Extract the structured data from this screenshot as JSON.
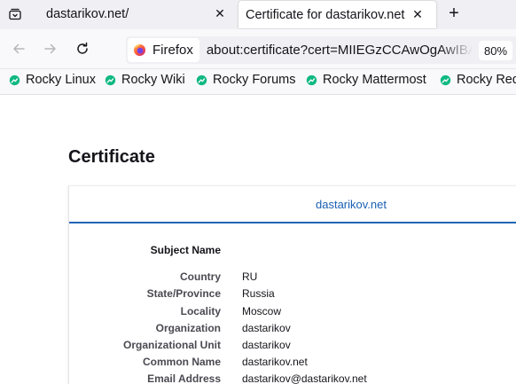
{
  "tabs": [
    {
      "title": "dastarikov.net/",
      "active": false
    },
    {
      "title": "Certificate for dastarikov.net",
      "active": true
    }
  ],
  "icons": {
    "tab_list": "tab-list-icon",
    "close": "close-icon",
    "new_tab": "plus-icon",
    "back": "arrow-left-icon",
    "forward": "arrow-right-icon",
    "reload": "reload-icon",
    "identity": "firefox-logo-icon",
    "bookmark": "rocky-logo-icon"
  },
  "glyphs": {
    "close": "✕",
    "new_tab": "+"
  },
  "urlbar": {
    "identity_label": "Firefox",
    "url": "about:certificate?cert=MIIEGzCCAwOgAwIBAgI",
    "zoom": "80%"
  },
  "bookmarks": [
    {
      "label": "Rocky Linux"
    },
    {
      "label": "Rocky Wiki"
    },
    {
      "label": "Rocky Forums"
    },
    {
      "label": "Rocky Mattermost"
    },
    {
      "label": "Rocky Red"
    }
  ],
  "page": {
    "title": "Certificate",
    "cert_tab": "dastarikov.net",
    "subject_section": "Subject Name",
    "fields": [
      {
        "label": "Country",
        "value": "RU"
      },
      {
        "label": "State/Province",
        "value": "Russia"
      },
      {
        "label": "Locality",
        "value": "Moscow"
      },
      {
        "label": "Organization",
        "value": "dastarikov"
      },
      {
        "label": "Organizational Unit",
        "value": "dastarikov"
      },
      {
        "label": "Common Name",
        "value": "dastarikov.net"
      },
      {
        "label": "Email Address",
        "value": "dastarikov@dastarikov.net"
      }
    ]
  },
  "colors": {
    "accent": "#2266b5",
    "link": "#1a5fb4",
    "rocky_green": "#10b981",
    "tabstrip_bg": "#f0f0f4",
    "toolbar_bg": "#f9f9fb"
  }
}
